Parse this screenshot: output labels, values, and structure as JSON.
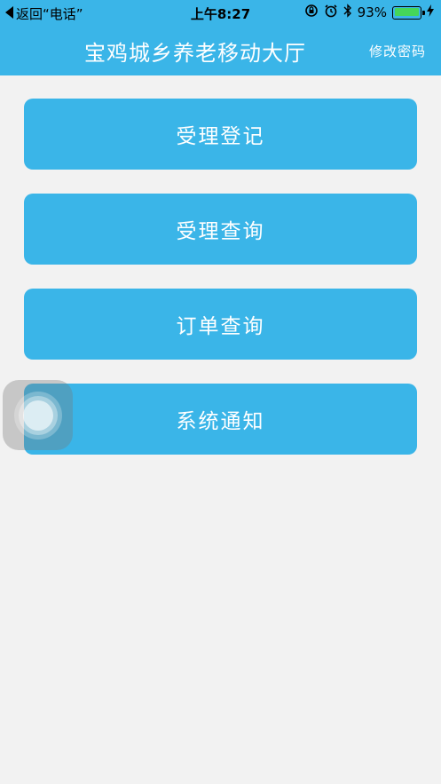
{
  "status_bar": {
    "back_label": "返回“电话”",
    "time": "上午8:27",
    "battery_percent": "93%",
    "battery_level": 0.93
  },
  "header": {
    "title": "宝鸡城乡养老移动大厅",
    "change_password_label": "修改密码",
    "background_color": "#3ab5e8"
  },
  "menu": {
    "items": [
      {
        "label": "受理登记"
      },
      {
        "label": "受理查询"
      },
      {
        "label": "订单查询"
      },
      {
        "label": "系统通知"
      }
    ]
  }
}
